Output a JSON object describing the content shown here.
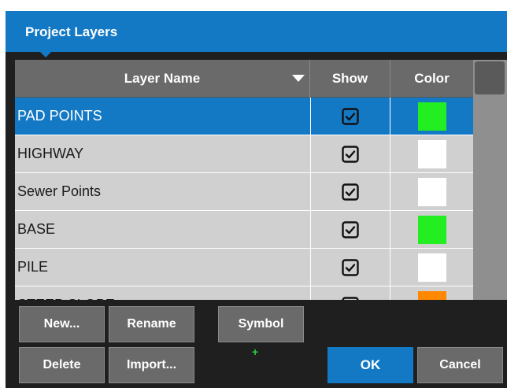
{
  "dialog": {
    "title": "Project Layers"
  },
  "table": {
    "headers": {
      "name": "Layer Name",
      "show": "Show",
      "color": "Color"
    },
    "rows": [
      {
        "name": "PAD POINTS",
        "show": true,
        "color": "#22ee22",
        "selected": true
      },
      {
        "name": "HIGHWAY",
        "show": true,
        "color": "#ffffff",
        "selected": false
      },
      {
        "name": "Sewer Points",
        "show": true,
        "color": "#ffffff",
        "selected": false
      },
      {
        "name": "BASE",
        "show": true,
        "color": "#22ee22",
        "selected": false
      },
      {
        "name": "PILE",
        "show": true,
        "color": "#ffffff",
        "selected": false
      },
      {
        "name": "STEEP SLOPE",
        "show": true,
        "color": "#ff8800",
        "selected": false
      }
    ]
  },
  "buttons": {
    "new": "New...",
    "rename": "Rename",
    "symbol": "Symbol",
    "delete": "Delete",
    "import": "Import...",
    "add": "+",
    "ok": "OK",
    "cancel": "Cancel"
  },
  "colors": {
    "accent": "#1479c5",
    "button": "#6a6a6a",
    "background": "#1f1f1f"
  }
}
